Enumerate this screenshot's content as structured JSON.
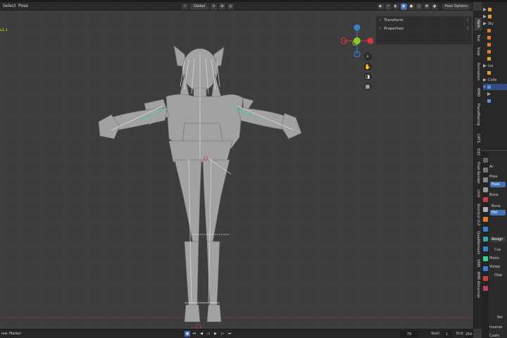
{
  "header": {
    "menu": [
      "Select",
      "Pose"
    ],
    "orientation": "Global",
    "pose_options": "Pose Options"
  },
  "viewport": {
    "corner_label": "x1.1"
  },
  "npanel": {
    "items": [
      "Transform",
      "Properties"
    ]
  },
  "side_tabs": [
    "Item",
    "Tool",
    "View",
    "Animation",
    "MMD",
    "PlaceMaking",
    "CATS",
    "Edit",
    "Pixel Render",
    "UniV",
    "Shortcut VUr",
    "QuadRemesh",
    "VRM",
    "BMR Abnormal"
  ],
  "timeline": {
    "left_label": "iew",
    "marker_label": "Marker",
    "current_frame": "79",
    "start_label": "Start",
    "start_value": "1",
    "end_label": "End",
    "end_value": "250"
  },
  "outliner": {
    "labels": [
      "Sty",
      "ico",
      "Colle"
    ]
  },
  "properties": {
    "header": "Ar",
    "rows": [
      "Pose",
      "Pose",
      "Bone",
      "Bone",
      "Hel",
      "Assign",
      "Cus",
      "Motio",
      "Viewp",
      "Disp",
      "Rel",
      "Inverse",
      "Custo"
    ]
  },
  "colors": {
    "accent": "#4772b3",
    "x_axis": "#d8343f",
    "y_axis": "#8ac926",
    "z_axis": "#3a7fd6",
    "selected_bone": "#40d090"
  }
}
